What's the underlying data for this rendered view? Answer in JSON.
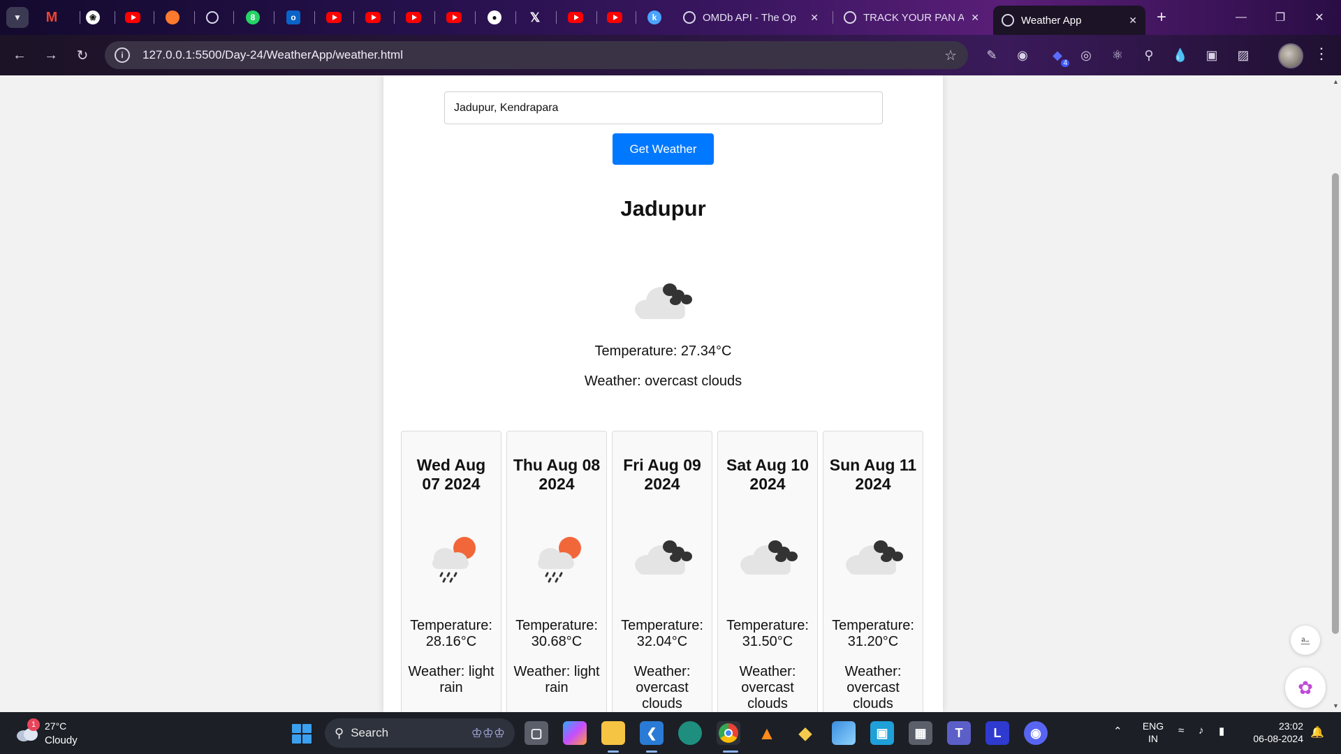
{
  "browser": {
    "tabs": [
      {
        "title": "OMDb API - The Op",
        "active": false
      },
      {
        "title": "TRACK YOUR PAN A",
        "active": false
      },
      {
        "title": "Weather App",
        "active": true
      }
    ],
    "url": "127.0.0.1:5500/Day-24/WeatherApp/weather.html",
    "extension_badge": "4"
  },
  "app": {
    "search_value": "Jadupur, Kendrapara",
    "button_label": "Get Weather",
    "current": {
      "city": "Jadupur",
      "icon": "overcast-clouds-icon",
      "temperature": "Temperature: 27.34°C",
      "weather": "Weather: overcast clouds"
    },
    "forecast": [
      {
        "date": "Wed Aug 07 2024",
        "icon": "light-rain-icon",
        "temperature": "Temperature: 28.16°C",
        "weather": "Weather: light rain"
      },
      {
        "date": "Thu Aug 08 2024",
        "icon": "light-rain-icon",
        "temperature": "Temperature: 30.68°C",
        "weather": "Weather: light rain"
      },
      {
        "date": "Fri Aug 09 2024",
        "icon": "overcast-clouds-icon",
        "temperature": "Temperature: 32.04°C",
        "weather": "Weather: overcast clouds"
      },
      {
        "date": "Sat Aug 10 2024",
        "icon": "overcast-clouds-icon",
        "temperature": "Temperature: 31.50°C",
        "weather": "Weather: overcast clouds"
      },
      {
        "date": "Sun Aug 11 2024",
        "icon": "overcast-clouds-icon",
        "temperature": "Temperature: 31.20°C",
        "weather": "Weather: overcast clouds"
      }
    ]
  },
  "taskbar": {
    "weather_temp": "27°C",
    "weather_condition": "Cloudy",
    "weather_badge": "1",
    "search_label": "Search",
    "lang_line1": "ENG",
    "lang_line2": "IN",
    "time": "23:02",
    "date": "06-08-2024"
  },
  "colors": {
    "button": "#0078ff",
    "card_bg": "#f9f9f9",
    "page_bg": "#f2f2f2"
  }
}
